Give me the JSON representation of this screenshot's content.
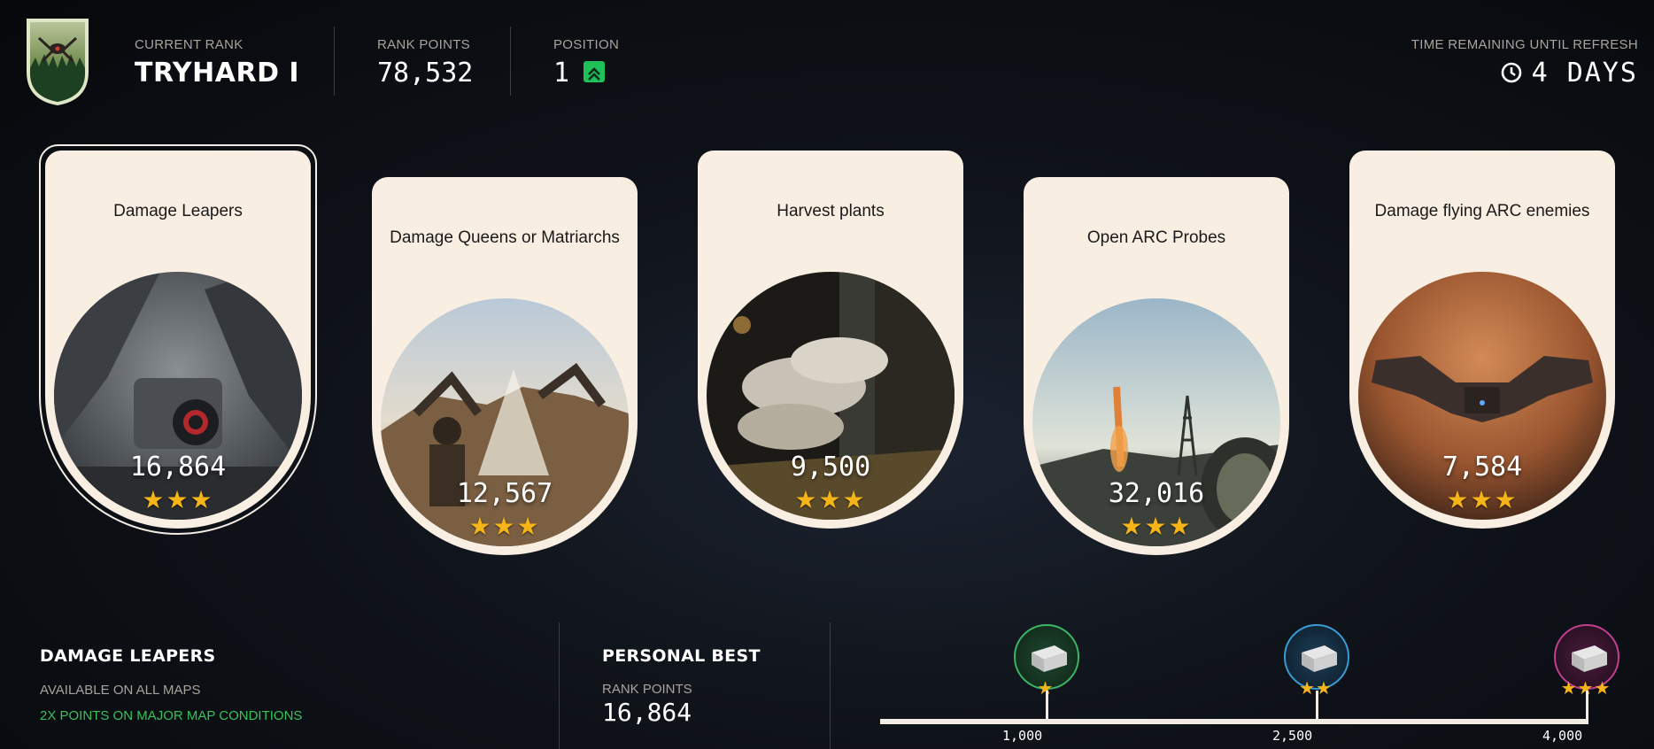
{
  "header": {
    "current_rank_label": "CURRENT RANK",
    "current_rank_value": "TRYHARD I",
    "rank_points_label": "RANK POINTS",
    "rank_points_value": "78,532",
    "position_label": "POSITION",
    "position_value": "1",
    "refresh_label": "TIME REMAINING UNTIL REFRESH",
    "refresh_value": "4 DAYS"
  },
  "cards": [
    {
      "title": "Damage Leapers",
      "points": "16,864",
      "stars": "★★★",
      "selected": true
    },
    {
      "title": "Damage Queens or Matriarchs",
      "points": "12,567",
      "stars": "★★★",
      "selected": false
    },
    {
      "title": "Harvest plants",
      "points": "9,500",
      "stars": "★★★",
      "selected": false
    },
    {
      "title": "Open ARC Probes",
      "points": "32,016",
      "stars": "★★★",
      "selected": false
    },
    {
      "title": "Damage flying ARC enemies",
      "points": "7,584",
      "stars": "★★★",
      "selected": false
    }
  ],
  "detail": {
    "title": "DAMAGE LEAPERS",
    "availability": "AVAILABLE ON ALL MAPS",
    "bonus": "2X POINTS ON MAJOR MAP CONDITIONS"
  },
  "personal_best": {
    "title": "PERSONAL BEST",
    "label": "RANK POINTS",
    "value": "16,864"
  },
  "milestones": [
    {
      "label": "1,000",
      "stars": "★",
      "ring_color": "#3bb567",
      "reached": true
    },
    {
      "label": "2,500",
      "stars": "★★",
      "ring_color": "#3a9bd6",
      "reached": true
    },
    {
      "label": "4,000",
      "stars": "★★★",
      "ring_color": "#c0408f",
      "reached": true
    }
  ],
  "colors": {
    "card_bg": "#f9eee2",
    "star": "#f5b417",
    "accent_green": "#34c25c",
    "position_badge": "#1fbf5a"
  },
  "icons": [
    "rank-emblem-icon",
    "position-up-icon",
    "clock-icon",
    "reward-crate-icon"
  ]
}
